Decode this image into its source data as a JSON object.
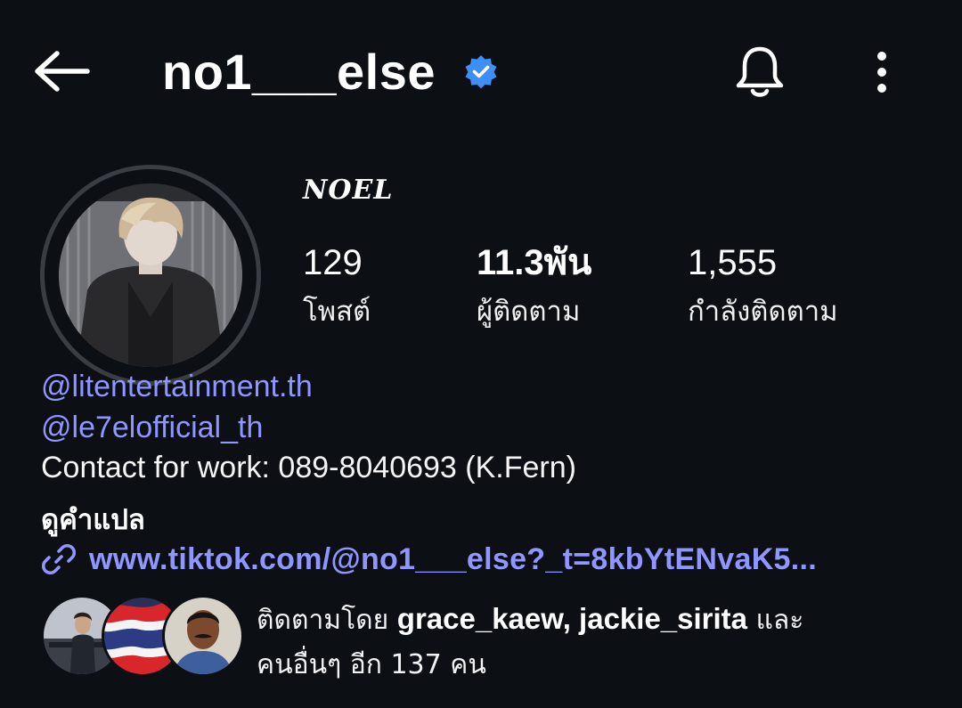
{
  "header": {
    "username": "no1___else",
    "back_icon": "arrow-left-icon",
    "verified_icon": "verified-badge-icon",
    "bell_icon": "bell-icon",
    "more_icon": "more-vertical-icon"
  },
  "profile": {
    "display_name": "𝑵𝑶𝑬𝑳",
    "stats": {
      "posts": {
        "value": "129",
        "label": "โพสต์"
      },
      "followers": {
        "value": "11.3พัน",
        "label": "ผู้ติดตาม"
      },
      "following": {
        "value": "1,555",
        "label": "กำลังติดตาม"
      }
    }
  },
  "bio": {
    "mention_1": "@litentertainment.th",
    "mention_2": "@le7elofficial_th",
    "contact": "Contact for work: 089-8040693 (K.Fern)",
    "translate_label": "ดูคำแปล",
    "link_icon": "link-icon",
    "link": "www.tiktok.com/@no1___else?_t=8kbYtENvaK5..."
  },
  "followed_by": {
    "prefix": "ติดตามโดย ",
    "user_1": "grace_kaew",
    "separator": ", ",
    "user_2": "jackie_sirita",
    "middle": " และ",
    "suffix": "คนอื่นๆ อีก 137 คน"
  },
  "colors": {
    "background": "#0c0f14",
    "link": "#8f96ff",
    "verified": "#3d8ff5"
  }
}
